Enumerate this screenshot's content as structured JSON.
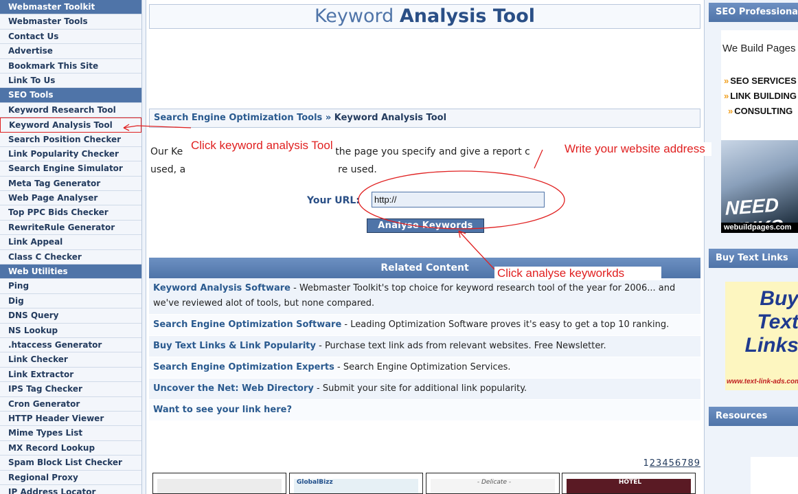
{
  "sidebar": {
    "items": [
      {
        "label": "Webmaster Toolkit",
        "type": "header"
      },
      {
        "label": "Webmaster Tools",
        "type": "link"
      },
      {
        "label": "Contact Us",
        "type": "link"
      },
      {
        "label": "Advertise",
        "type": "link"
      },
      {
        "label": "Bookmark This Site",
        "type": "link"
      },
      {
        "label": "Link To Us",
        "type": "link"
      },
      {
        "label": "SEO Tools",
        "type": "header"
      },
      {
        "label": "Keyword Research Tool",
        "type": "link"
      },
      {
        "label": "Keyword Analysis Tool",
        "type": "active"
      },
      {
        "label": "Search Position Checker",
        "type": "link"
      },
      {
        "label": "Link Popularity Checker",
        "type": "link"
      },
      {
        "label": "Search Engine Simulator",
        "type": "link"
      },
      {
        "label": "Meta Tag Generator",
        "type": "link"
      },
      {
        "label": "Web Page Analyser",
        "type": "link"
      },
      {
        "label": "Top PPC Bids Checker",
        "type": "link"
      },
      {
        "label": "RewriteRule Generator",
        "type": "link"
      },
      {
        "label": "Link Appeal",
        "type": "link"
      },
      {
        "label": "Class C Checker",
        "type": "link"
      },
      {
        "label": "Web Utilities",
        "type": "header"
      },
      {
        "label": "Ping",
        "type": "link"
      },
      {
        "label": "Dig",
        "type": "link"
      },
      {
        "label": "DNS Query",
        "type": "link"
      },
      {
        "label": "NS Lookup",
        "type": "link"
      },
      {
        "label": ".htaccess Generator",
        "type": "link"
      },
      {
        "label": "Link Checker",
        "type": "link"
      },
      {
        "label": "Link Extractor",
        "type": "link"
      },
      {
        "label": "IPS Tag Checker",
        "type": "link"
      },
      {
        "label": "Cron Generator",
        "type": "link"
      },
      {
        "label": "HTTP Header Viewer",
        "type": "link"
      },
      {
        "label": "Mime Types List",
        "type": "link"
      },
      {
        "label": "MX Record Lookup",
        "type": "link"
      },
      {
        "label": "Spam Block List Checker",
        "type": "link"
      },
      {
        "label": "Regional Proxy",
        "type": "link"
      },
      {
        "label": "IP Address Locator",
        "type": "link"
      }
    ]
  },
  "main": {
    "title_light": "Keyword",
    "title_bold": "Analysis Tool",
    "breadcrumb": {
      "parent": "Search Engine Optimization Tools",
      "separator": "»",
      "current": "Keyword Analysis Tool"
    },
    "intro_line1_a": "Our Ke",
    "intro_line1_b": "the page you specify and give a report c",
    "intro_line2_a": "used, a",
    "intro_line2_b": "re used.",
    "url_label": "Your URL:",
    "url_value": "http://",
    "analyse_button": "Analyse Keywords",
    "related_header": "Related Content",
    "related": [
      {
        "link": "Keyword Analysis Software",
        "text": " - Webmaster Toolkit's top choice for keyword research tool of the year for 2006... and we've reviewed alot of tools, but none compared."
      },
      {
        "link": "Search Engine Optimization Software",
        "text": " - Leading Optimization Software proves it's easy to get a top 10 ranking."
      },
      {
        "link": "Buy Text Links & Link Popularity",
        "text": " - Purchase text link ads from relevant websites. Free Newsletter."
      },
      {
        "link": "Search Engine Optimization Experts",
        "text": " - Search Engine Optimization Services."
      },
      {
        "link": "Uncover the Net: Web Directory",
        "text": " - Submit your site for additional link popularity."
      },
      {
        "link": "Want to see your link here?",
        "text": ""
      }
    ],
    "pager": [
      "1",
      "2",
      "3",
      "4",
      "5",
      "6",
      "7",
      "8",
      "9"
    ],
    "thumbs": [
      "",
      "GlobalBizz",
      "- Delicate -",
      "HOTEL"
    ]
  },
  "annotations": {
    "click_tool": "Click keyword analysis Tool",
    "write_address": "Write your website address",
    "click_analyse": "Click analyse keyworkds"
  },
  "right": {
    "head1": "SEO Professionals",
    "ad1_tagline": "We Build Pages",
    "ad1_services": [
      "SEO SERVICES",
      "LINK BUILDING",
      "CONSULTING"
    ],
    "ad1_photo_text": "NEED LINKS",
    "ad1_footer": "webuildpages.com",
    "head2": "Buy Text Links",
    "ad2_lines": [
      "Buy",
      "Text",
      "Links"
    ],
    "ad2_url": "www.text-link-ads.com",
    "head3": "Resources"
  },
  "colors": {
    "accent": "#4f74a8",
    "annotation": "#e02020"
  }
}
